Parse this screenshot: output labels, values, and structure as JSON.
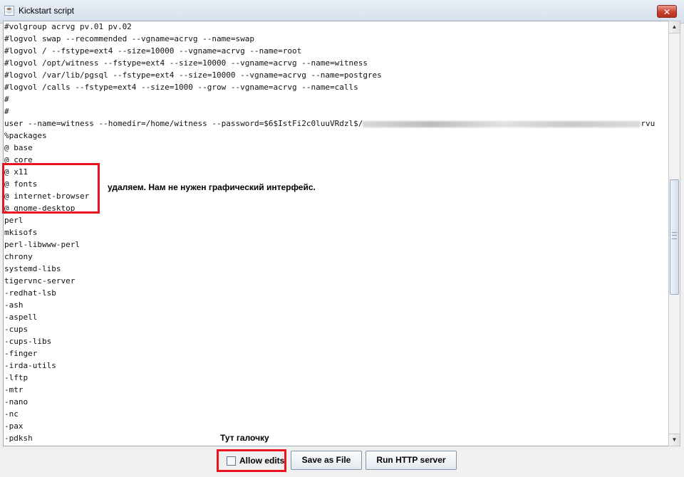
{
  "window": {
    "title": "Kickstart script",
    "close_glyph": "✕"
  },
  "editor": {
    "lines": [
      "#volgroup acrvg pv.01 pv.02",
      "#logvol swap --recommended --vgname=acrvg --name=swap",
      "#logvol / --fstype=ext4 --size=10000 --vgname=acrvg --name=root",
      "#logvol /opt/witness --fstype=ext4 --size=10000 --vgname=acrvg --name=witness",
      "#logvol /var/lib/pgsql --fstype=ext4 --size=10000 --vgname=acrvg --name=postgres",
      "#logvol /calls --fstype=ext4 --size=1000 --grow --vgname=acrvg --name=calls",
      "#",
      "#",
      "user --name=witness --homedir=/home/witness --password=$6$IstFi2c0luuVRdzl$/",
      "%packages",
      "@ base",
      "@ core",
      "@ x11",
      "@ fonts",
      "@ internet-browser",
      "@ gnome-desktop",
      "perl",
      "mkisofs",
      "perl-libwww-perl",
      "chrony",
      "systemd-libs",
      "tigervnc-server",
      "-redhat-lsb",
      "-ash",
      "-aspell",
      "-cups",
      "-cups-libs",
      "-finger",
      "-irda-utils",
      "-lftp",
      "-mtr",
      "-nano",
      "-nc",
      "-pax",
      "-pdksh"
    ],
    "user_line_suffix": "rvu"
  },
  "annotations": {
    "remove_note": "удаляем. Нам не нужен графический интерфейс.",
    "checkbox_note": "Тут галочку",
    "highlight_color": "#e8141e"
  },
  "footer": {
    "allow_edits_label": "Allow edits",
    "allow_edits_checked": false,
    "save_label": "Save as File",
    "run_label": "Run HTTP server"
  },
  "scrollbar": {
    "up_glyph": "▲",
    "down_glyph": "▼"
  }
}
